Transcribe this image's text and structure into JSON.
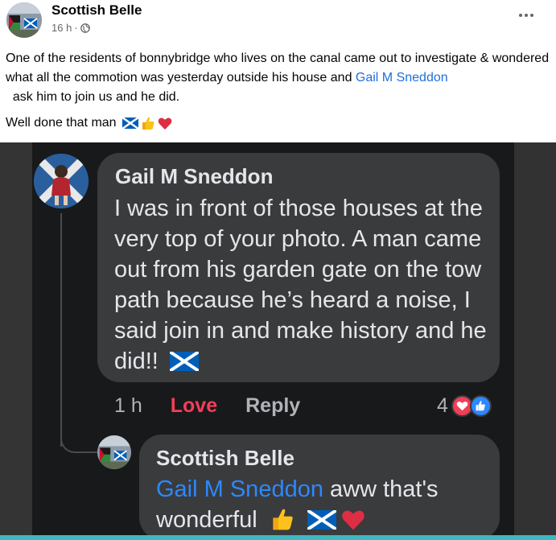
{
  "post": {
    "author": "Scottish Belle",
    "time": "16 h",
    "separator": "·",
    "text_before_mention": "One of the residents of bonnybridge who lives on the canal came out to investigate & wondered what all the commotion was yesterday outside his house and ",
    "mention": "Gail M Sneddon",
    "text_after_mention": "  ask him to join us and he did.",
    "line2": "Well done that man",
    "line2_emojis": [
      "scottish-flag",
      "thumbs-up",
      "red-heart"
    ]
  },
  "screenshot": {
    "comment": {
      "author": "Gail M Sneddon",
      "text": "I was in front of those houses at the very top of your photo. A man came out from his garden gate on the tow path because he’s heard a noise, I said join in and make history and he did!!",
      "time": "1 h",
      "love_label": "Love",
      "reply_label": "Reply",
      "reaction_count": "4"
    },
    "reply": {
      "author": "Scottish Belle",
      "mention": "Gail M Sneddon",
      "text": " aww that's wonderful"
    }
  },
  "colors": {
    "mention_blue": "#216fdb",
    "dark_bubble": "#3a3b3c",
    "love_red": "#f33e58",
    "like_blue": "#2d88ff",
    "bottom_bar": "#3fb8c2"
  }
}
